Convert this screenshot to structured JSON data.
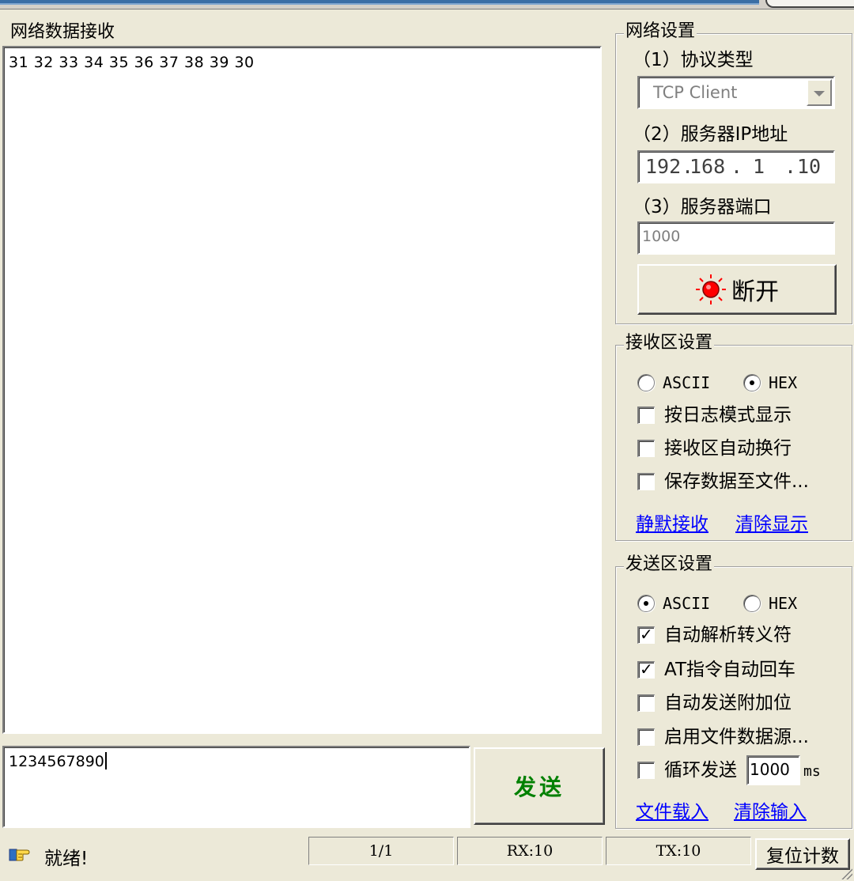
{
  "receive": {
    "title": "网络数据接收",
    "content": "31 32 33 34 35 36 37 38 39 30"
  },
  "send": {
    "input_value": "1234567890",
    "button_label": "发送"
  },
  "net_settings": {
    "title": "网络设置",
    "protocol_label": "（1）协议类型",
    "protocol_value": "TCP Client",
    "server_ip_label": "（2）服务器IP地址",
    "ip": [
      "192",
      "168",
      "1",
      "10"
    ],
    "ip_dots": [
      ".",
      ".",
      "."
    ],
    "server_port_label": "（3）服务器端口",
    "port_value": "1000",
    "disconnect_label": "断开",
    "status_color": "#ff0000"
  },
  "recv_settings": {
    "title": "接收区设置",
    "ascii_label": "ASCII",
    "hex_label": "HEX",
    "selected_mode": "HEX",
    "options": [
      {
        "label": "按日志模式显示",
        "checked": false
      },
      {
        "label": "接收区自动换行",
        "checked": false
      },
      {
        "label": "保存数据至文件...",
        "checked": false
      }
    ],
    "link_silent": "静默接收",
    "link_clear": "清除显示"
  },
  "send_settings": {
    "title": "发送区设置",
    "ascii_label": "ASCII",
    "hex_label": "HEX",
    "selected_mode": "ASCII",
    "options": [
      {
        "label": "自动解析转义符",
        "checked": true
      },
      {
        "label": "AT指令自动回车",
        "checked": true
      },
      {
        "label": "自动发送附加位",
        "checked": false
      },
      {
        "label": "启用文件数据源...",
        "checked": false
      }
    ],
    "loop_label": "循环发送",
    "loop_interval": "1000",
    "loop_unit": "ms",
    "link_load": "文件载入",
    "link_clear": "清除输入"
  },
  "status": {
    "text": "就绪!",
    "page": "1/1",
    "rx": "RX:10",
    "tx": "TX:10",
    "reset_label": "复位计数"
  },
  "icons": {
    "status": "pointing-hand-icon",
    "led": "red-led-icon"
  }
}
